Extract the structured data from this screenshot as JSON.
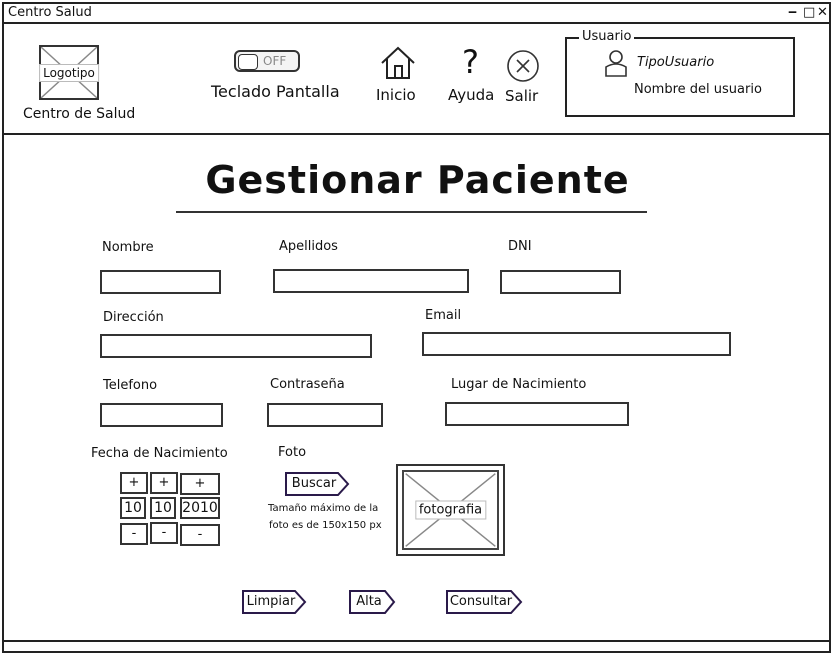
{
  "window": {
    "title": "Centro Salud",
    "controls": [
      "‒",
      "□",
      "✕"
    ]
  },
  "header": {
    "logo_placeholder": "Logotipo",
    "center_name": "Centro de Salud",
    "keyboard_toggle": {
      "state": "OFF",
      "label": "Teclado Pantalla"
    },
    "nav": {
      "home": "Inicio",
      "help": "Ayuda",
      "exit": "Salir"
    },
    "user_panel": {
      "legend": "Usuario",
      "user_type": "TipoUsuario",
      "user_name": "Nombre del usuario"
    }
  },
  "page": {
    "title": "Gestionar Paciente"
  },
  "form": {
    "labels": {
      "nombre": "Nombre",
      "apellidos": "Apellidos",
      "dni": "DNI",
      "direccion": "Dirección",
      "email": "Email",
      "telefono": "Telefono",
      "contrasena": "Contraseña",
      "lugar_nacimiento": "Lugar de Nacimiento",
      "fecha_nacimiento": "Fecha de Nacimiento",
      "foto": "Foto"
    },
    "birth_date": {
      "day": "10",
      "month": "10",
      "year": "2010",
      "plus": "+",
      "minus": "-"
    },
    "photo": {
      "search_button": "Buscar",
      "note_line1": "Tamaño máximo de la",
      "note_line2": "foto es de 150x150 px",
      "placeholder": "fotografia"
    },
    "actions": {
      "clear": "Limpiar",
      "add": "Alta",
      "query": "Consultar"
    }
  }
}
